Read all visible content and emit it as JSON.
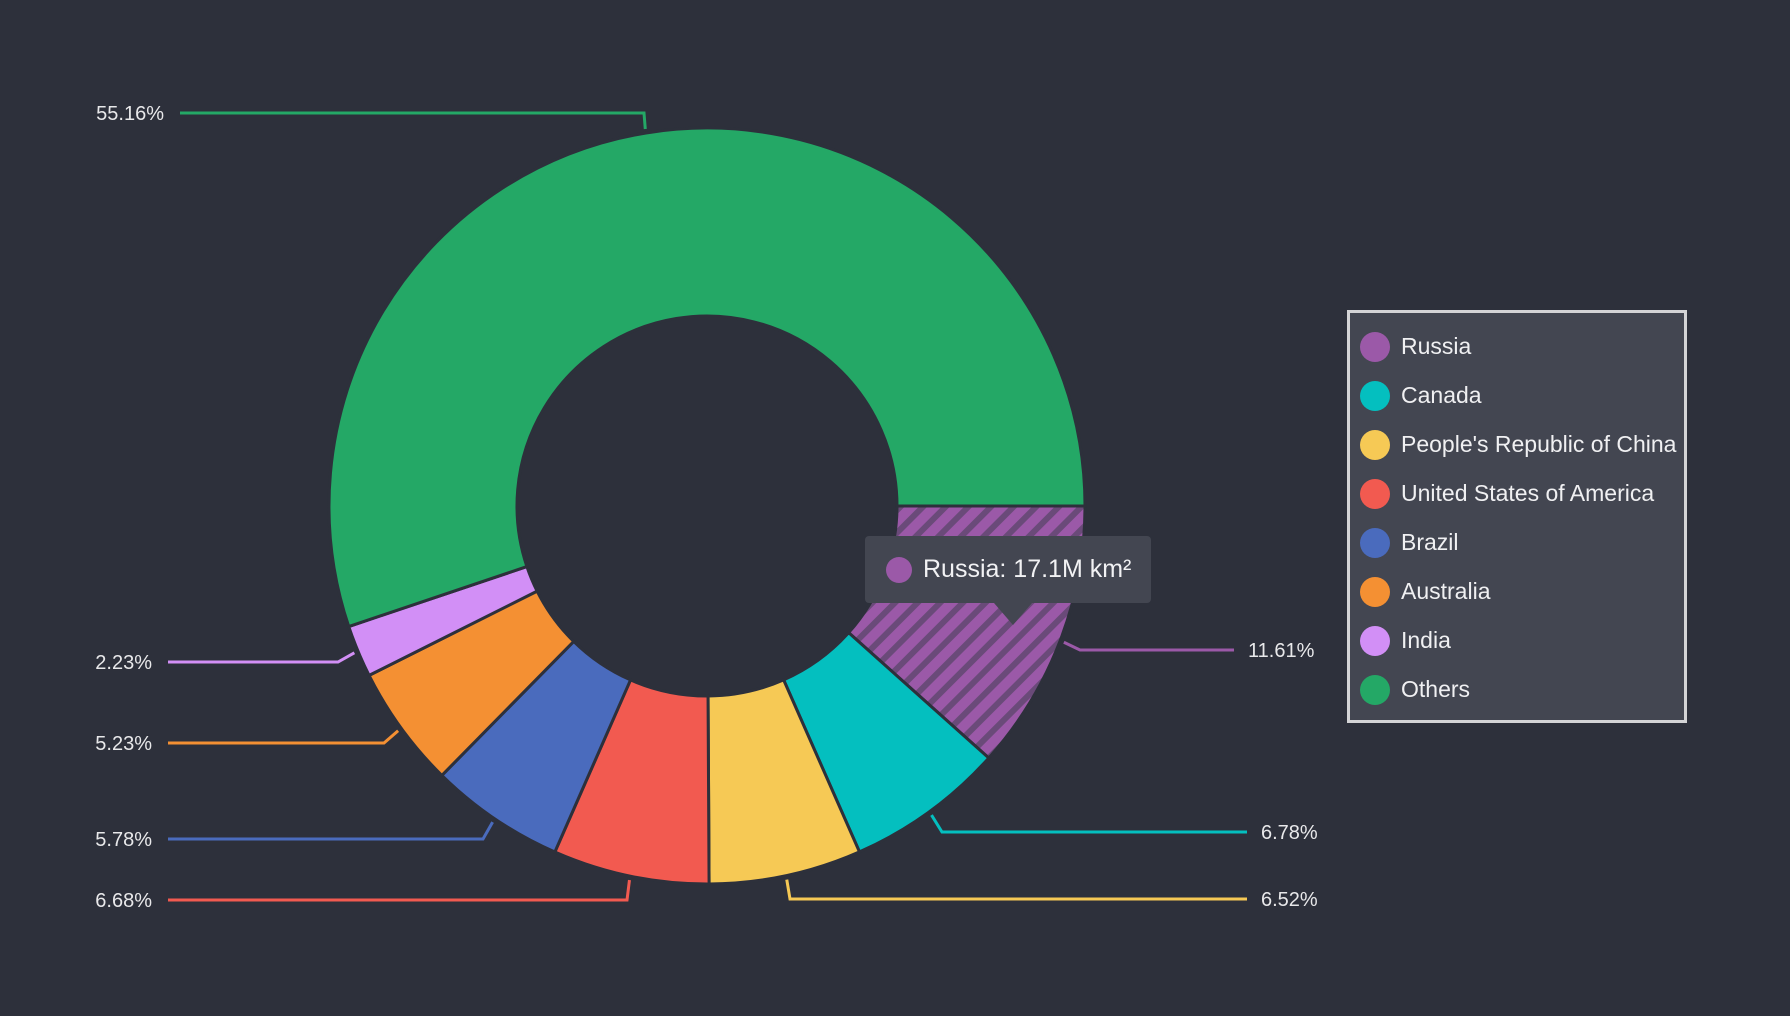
{
  "chart_data": {
    "type": "pie",
    "variant": "donut",
    "title": "",
    "start_angle_deg": 0,
    "direction": "clockwise",
    "unit": "M km²",
    "slices": [
      {
        "name": "Russia",
        "percent": 11.61,
        "value": 17.1,
        "color": "#9b59a8",
        "highlighted": true
      },
      {
        "name": "Canada",
        "percent": 6.78,
        "color": "#04bfbf"
      },
      {
        "name": "People's Republic of China",
        "percent": 6.52,
        "color": "#f6c955"
      },
      {
        "name": "United States of America",
        "percent": 6.68,
        "color": "#f25a50"
      },
      {
        "name": "Brazil",
        "percent": 5.78,
        "color": "#4a6bbd"
      },
      {
        "name": "Australia",
        "percent": 5.23,
        "color": "#f49033"
      },
      {
        "name": "India",
        "percent": 2.23,
        "color": "#d28ff6"
      },
      {
        "name": "Others",
        "percent": 55.16,
        "color": "#24a866"
      }
    ],
    "data_labels": [
      "11.61%",
      "6.78%",
      "6.52%",
      "6.68%",
      "5.78%",
      "5.23%",
      "2.23%",
      "55.16%"
    ],
    "legend_position": "right"
  },
  "legend": {
    "items": [
      {
        "label": "Russia",
        "color": "#9b59a8"
      },
      {
        "label": "Canada",
        "color": "#04bfbf"
      },
      {
        "label": "People's Republic of China",
        "color": "#f6c955"
      },
      {
        "label": "United States of America",
        "color": "#f25a50"
      },
      {
        "label": "Brazil",
        "color": "#4a6bbd"
      },
      {
        "label": "Australia",
        "color": "#f49033"
      },
      {
        "label": "India",
        "color": "#d28ff6"
      },
      {
        "label": "Others",
        "color": "#24a866"
      }
    ]
  },
  "tooltip": {
    "text": "Russia: 17.1M km²",
    "color": "#9b59a8"
  },
  "colors": {
    "background": "#2d303b",
    "panel": "#434651",
    "legend_border": "#d4d4d6",
    "hatch_dark": "#6a4a79"
  }
}
